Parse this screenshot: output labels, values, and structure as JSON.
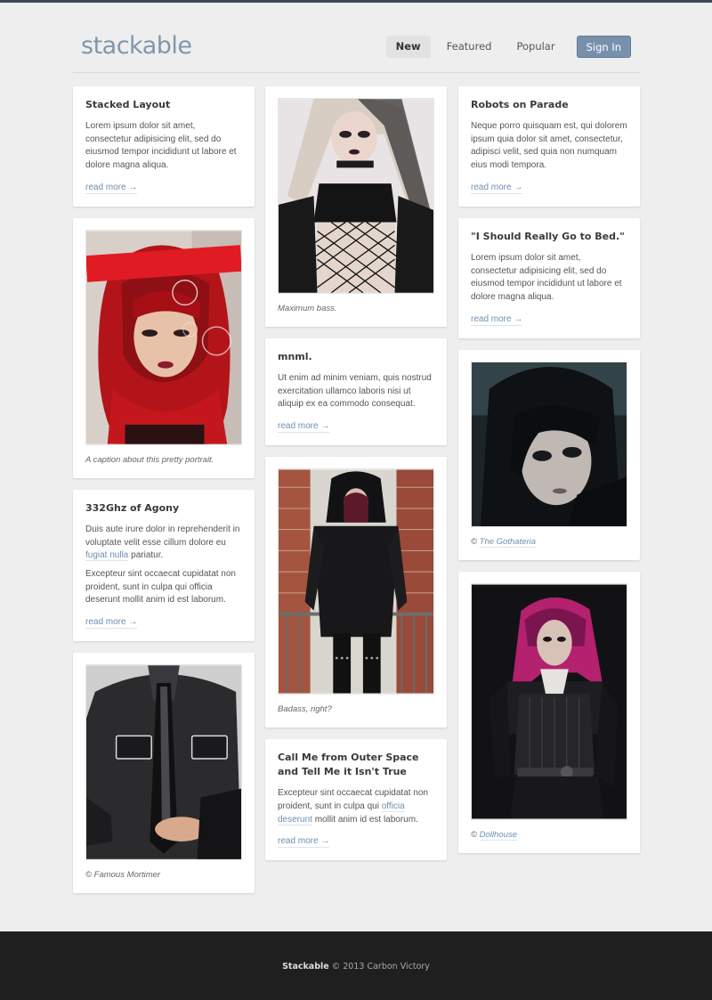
{
  "brand": "stackable",
  "nav": [
    {
      "label": "New"
    },
    {
      "label": "Featured"
    },
    {
      "label": "Popular"
    }
  ],
  "signin_label": "Sign In",
  "posts": {
    "stacked": {
      "title": "Stacked Layout",
      "body": "Lorem ipsum dolor sit amet, consectetur adipisicing elit, sed do eiusmod tempor incididunt ut labore et dolore magna aliqua.",
      "more": "read more →"
    },
    "portrait": {
      "caption": "A caption about this pretty portrait."
    },
    "agony": {
      "title": "332Ghz of Agony",
      "body1_a": "Duis aute irure dolor in reprehenderit in voluptate velit esse cillum dolore eu ",
      "body1_link": "fugiat nulla",
      "body1_b": " pariatur.",
      "body2": "Excepteur sint occaecat cupidatat non proident, sunt in culpa qui officia deserunt mollit anim id est laborum.",
      "more": "read more →"
    },
    "mortimer": {
      "caption": "© Famous Mortimer"
    },
    "bass": {
      "caption": "Maximum bass."
    },
    "mnml": {
      "title": "mnml.",
      "body": "Ut enim ad minim veniam, quis nostrud exercitation ullamco laboris nisi ut aliquip ex ea commodo consequat.",
      "more": "read more →"
    },
    "badass": {
      "caption": "Badass, right?"
    },
    "outer": {
      "title": "Call Me from Outer Space and Tell Me it Isn't True",
      "body_a": "Excepteur sint occaecat cupidatat non proident, sunt in culpa qui ",
      "body_link": "officia deserunt",
      "body_b": " mollit anim id est laborum.",
      "more": "read more →"
    },
    "robots": {
      "title": "Robots on Parade",
      "body": "Neque porro quisquam est, qui dolorem ipsum quia dolor sit amet, consectetur, adipisci velit, sed quia non numquam eius modi tempora.",
      "more": "read more →"
    },
    "bed": {
      "title": "\"I Should Really Go to Bed.\"",
      "body": "Lorem ipsum dolor sit amet, consectetur adipisicing elit, sed do eiusmod tempor incididunt ut labore et dolore magna aliqua.",
      "more": "read more →"
    },
    "gothateria": {
      "caption_prefix": "© ",
      "caption_link": "The Gothateria"
    },
    "dollhouse": {
      "caption_prefix": "© ",
      "caption_link": "Dollhouse"
    }
  },
  "footer": {
    "brand": "Stackable",
    "text": " © 2013 Carbon Victory"
  }
}
